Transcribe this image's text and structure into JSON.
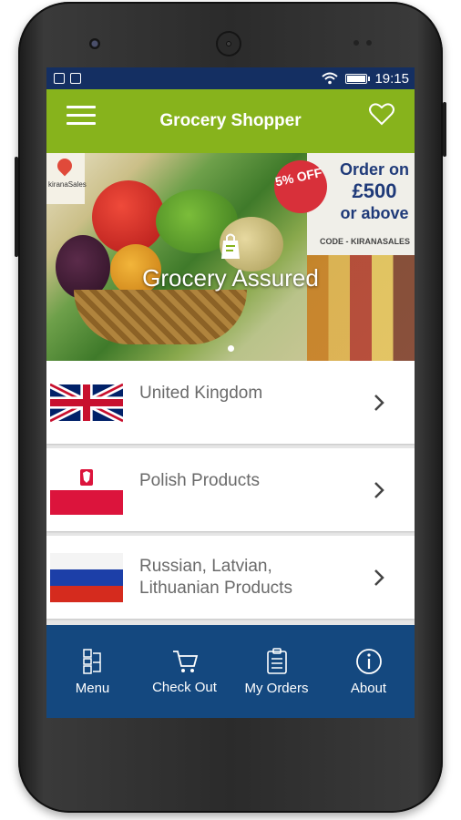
{
  "status_bar": {
    "time": "19:15"
  },
  "app_bar": {
    "title": "Grocery Shopper"
  },
  "banner": {
    "caption": "Grocery Assured",
    "brand": "kiranaSales",
    "discount": "5% OFF",
    "offer_line1": "Order on",
    "offer_line2": "£500",
    "offer_line3": "or above",
    "code": "CODE - KIRANASALES"
  },
  "categories": [
    {
      "label": "United Kingdom",
      "flag": "uk-flag"
    },
    {
      "label": "Polish Products",
      "flag": "poland-flag"
    },
    {
      "label_line1": "Russian, Latvian,",
      "label_line2": "Lithuanian Products",
      "flag": "russia-flag"
    }
  ],
  "bottom_nav": [
    {
      "label": "Menu",
      "icon": "menu-list-icon"
    },
    {
      "label": "Check Out",
      "icon": "cart-icon"
    },
    {
      "label": "My Orders",
      "icon": "clipboard-icon"
    },
    {
      "label": "About",
      "icon": "info-icon"
    }
  ],
  "colors": {
    "status_bar": "#142f62",
    "app_bar": "#87b31c",
    "bottom_nav": "#14487f"
  }
}
